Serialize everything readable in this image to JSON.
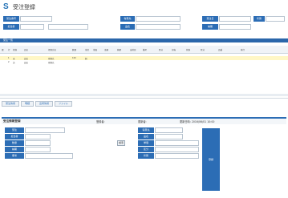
{
  "app": {
    "title": "受注登録"
  },
  "filter": {
    "row1": [
      {
        "label": "受注番号",
        "value": ""
      },
      {
        "label": "得意先",
        "value": ""
      },
      {
        "label": "受注日",
        "value": ""
      },
      {
        "label": "状態",
        "value": ""
      }
    ],
    "row2": [
      {
        "label": "担当者",
        "value": ""
      },
      {
        "label": "品名",
        "value": ""
      },
      {
        "label": "納期",
        "value": ""
      }
    ]
  },
  "list": {
    "header": "受注一覧",
    "columns": [
      "選",
      "行",
      "状態",
      "品名",
      "得意先名",
      "数量",
      "単位",
      "単価",
      "金額",
      "納期",
      "出荷日",
      "備考",
      "区分",
      "担当",
      "状態",
      "区分",
      "品番",
      "発行"
    ],
    "rows": [
      [
        "",
        "1",
        "未",
        "品名",
        "得意先",
        "100",
        "個",
        "",
        "",
        "",
        "",
        "",
        "",
        "",
        "",
        "",
        "",
        ""
      ],
      [
        "",
        "2",
        "済",
        "品名",
        "得意先",
        "",
        "",
        "",
        "",
        "",
        "",
        "",
        "",
        "",
        "",
        "",
        "",
        ""
      ]
    ]
  },
  "tabs": [
    "受注情報",
    "明細",
    "出荷情報",
    "ファイル"
  ],
  "detail": {
    "title": "受注情報登録",
    "meta1": "登録者:",
    "meta2": "更新者:",
    "meta3": "更新日時: 2016/06/01 10:00",
    "fields": [
      {
        "label": "受注",
        "value": ""
      },
      {
        "label": "得意先",
        "value": ""
      },
      {
        "label": "担当者",
        "value": ""
      },
      {
        "label": "品名",
        "value": ""
      },
      {
        "label": "数量",
        "value": ""
      },
      {
        "label": "単価",
        "value": ""
      },
      {
        "label": "納期",
        "value": ""
      },
      {
        "label": "区分",
        "value": ""
      },
      {
        "label": "備考",
        "value": ""
      },
      {
        "label": "状態",
        "value": ""
      }
    ],
    "side_button": "登録",
    "search_label": "検索"
  }
}
